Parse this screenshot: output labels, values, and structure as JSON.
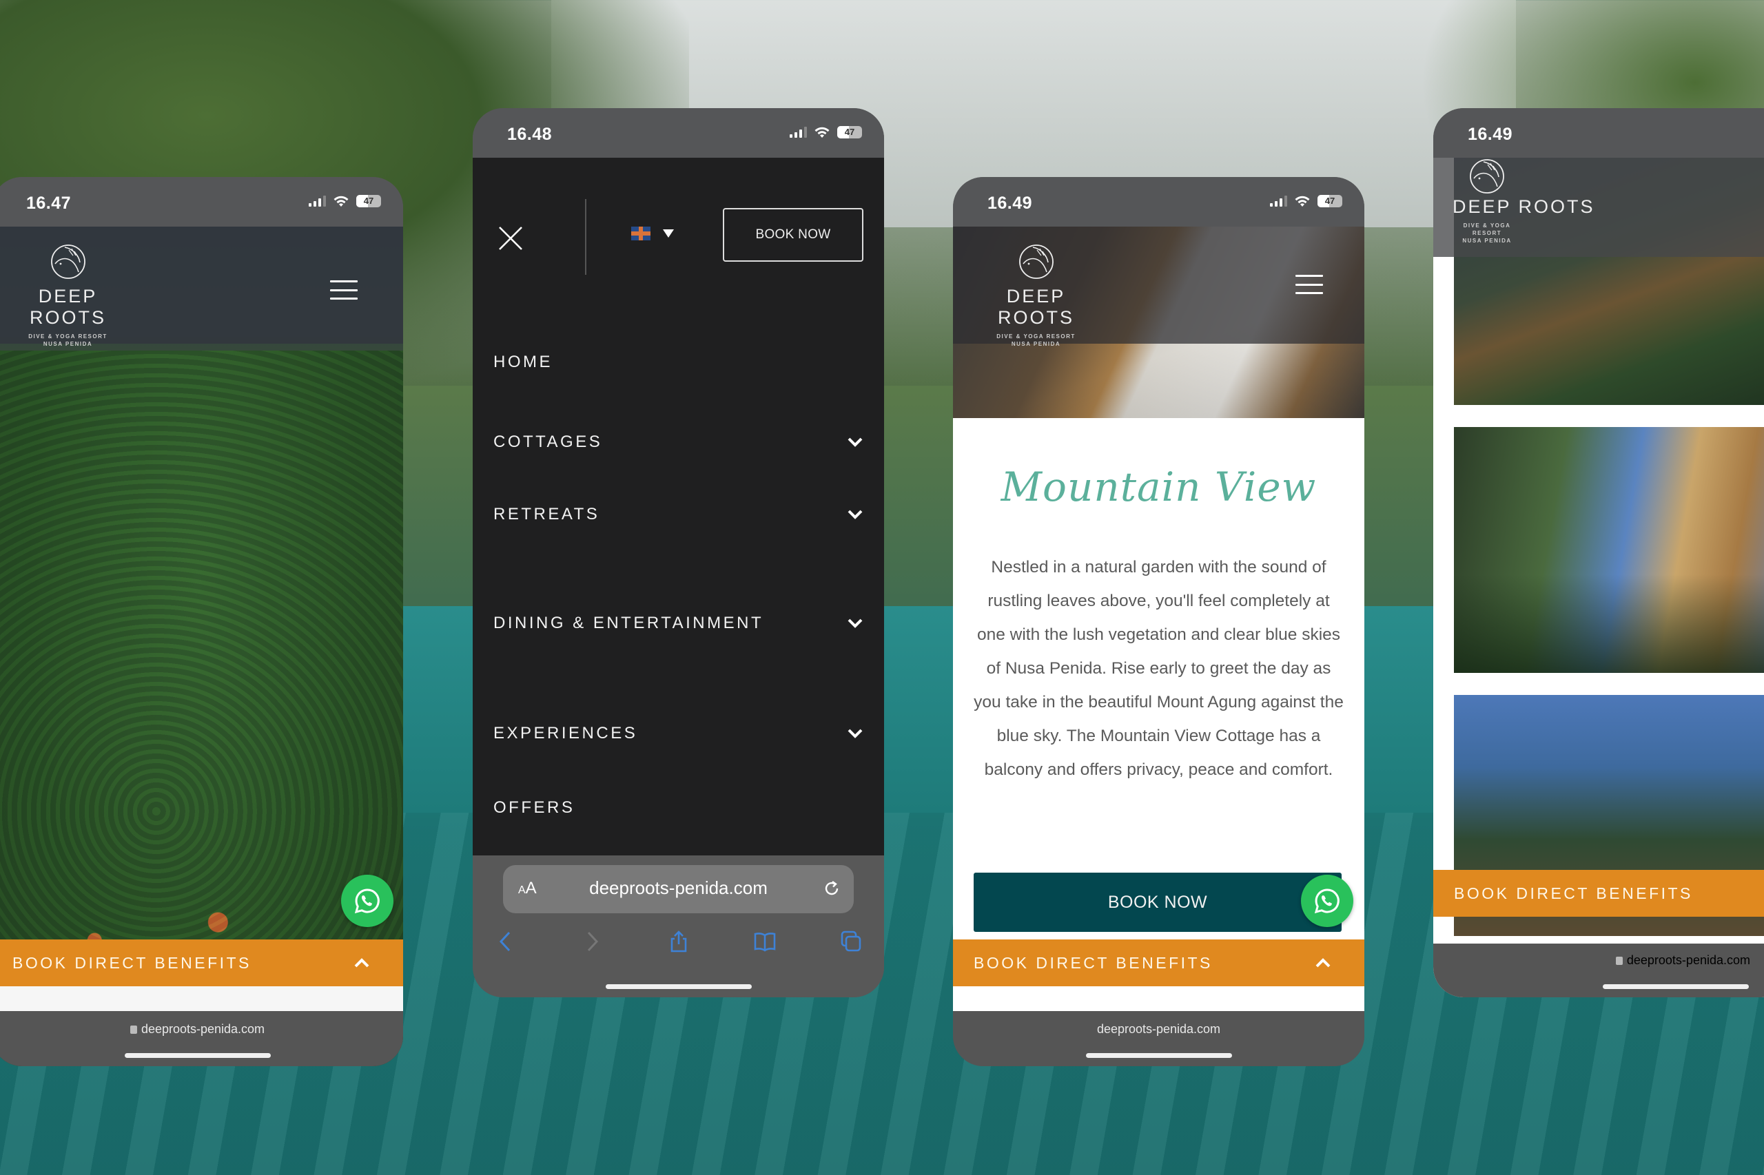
{
  "brand": {
    "name": "DEEP ROOTS",
    "tagline_line1": "DIVE & YOGA RESORT",
    "tagline_line2": "NUSA PENIDA",
    "logo_icon": "fish-leaf-circle-icon"
  },
  "colors": {
    "accent_orange": "#e0891f",
    "teal_button": "#03474f",
    "script_green": "#5bb09b",
    "whatsapp_green": "#29c15b",
    "menu_bg": "#1f1f20",
    "safari_blue": "#3e82d6"
  },
  "phones": [
    {
      "status": {
        "time": "16.47",
        "battery": "47"
      },
      "whatsapp_icon": "whatsapp-icon",
      "benefits_label": "BOOK DIRECT BENEFITS",
      "url": "deeproots-penida.com"
    },
    {
      "status": {
        "time": "16.48",
        "battery": "47"
      },
      "menu": {
        "book_now": "BOOK NOW",
        "language_icon": "uk-flag-icon",
        "items": [
          {
            "label": "HOME",
            "has_submenu": false
          },
          {
            "label": "COTTAGES",
            "has_submenu": true
          },
          {
            "label": "RETREATS",
            "has_submenu": true
          },
          {
            "label": "DINING & ENTERTAINMENT",
            "has_submenu": true
          },
          {
            "label": "EXPERIENCES",
            "has_submenu": true
          },
          {
            "label": "OFFERS",
            "has_submenu": false
          }
        ]
      },
      "safari": {
        "aa_label_small": "A",
        "aa_label_large": "A",
        "url": "deeproots-penida.com"
      }
    },
    {
      "status": {
        "time": "16.49",
        "battery": "47"
      },
      "title": "Mountain View",
      "description": "Nestled in a natural garden with the sound of rustling leaves above, you'll feel completely at one with the lush vegetation and clear blue skies of Nusa Penida. Rise early to greet the day as you take in the beautiful Mount Agung against the blue sky. The Mountain View Cottage has a balcony and offers privacy, peace and comfort.",
      "book_now": "BOOK NOW",
      "benefits_label": "BOOK DIRECT BENEFITS",
      "url": "deeproots-penida.com"
    },
    {
      "status": {
        "time": "16.49"
      },
      "benefits_label": "BOOK DIRECT BENEFITS",
      "url": "deeproots-penida.com"
    }
  ]
}
